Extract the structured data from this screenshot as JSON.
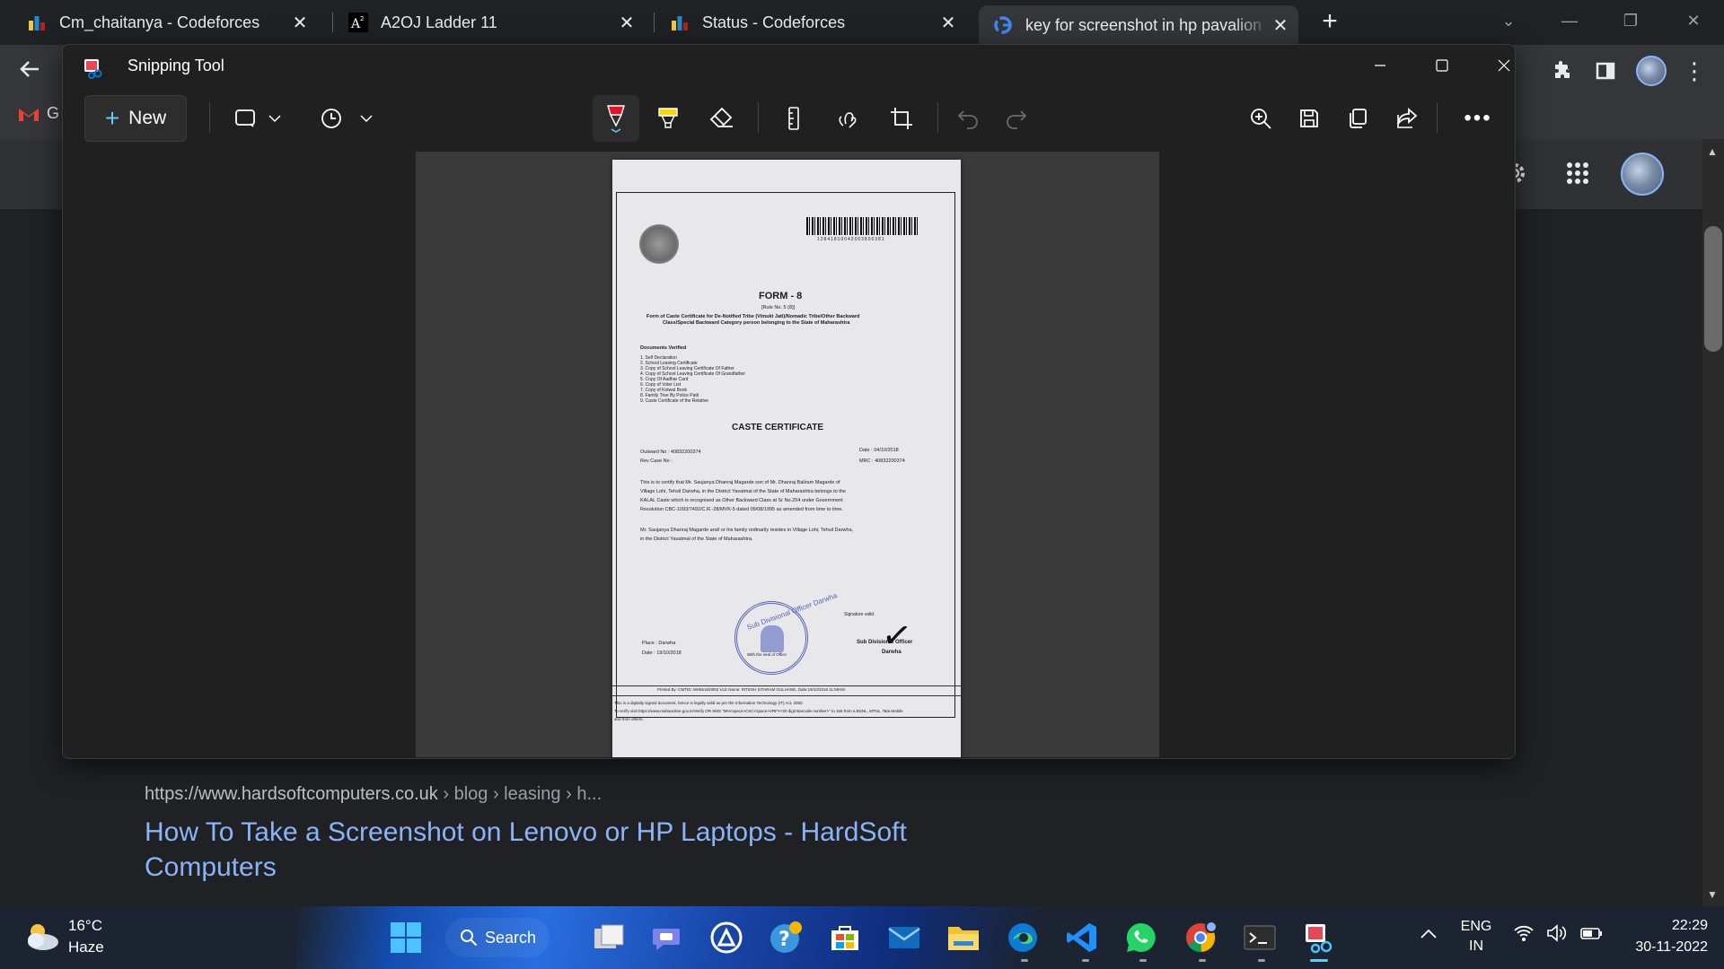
{
  "browser": {
    "tabs": [
      {
        "title": "Cm_chaitanya - Codeforces",
        "icon": "codeforces-icon",
        "active": false
      },
      {
        "title": "A2OJ Ladder 11",
        "icon": "a2oj-icon",
        "active": false
      },
      {
        "title": "Status - Codeforces",
        "icon": "codeforces-icon",
        "active": false
      },
      {
        "title": "key for screenshot in hp pavalion",
        "icon": "google-icon",
        "active": true
      }
    ],
    "new_tab": "+",
    "bookmark_gmail": "G",
    "colors": {
      "frame": "#202124",
      "toolbar": "#35363a",
      "link": "#8ab4f8"
    }
  },
  "search_result": {
    "url": "https://www.hardsoftcomputers.co.uk",
    "crumbs": "› blog › leasing › h...",
    "title": "How To Take a Screenshot on Lenovo or HP Laptops - HardSoft Computers"
  },
  "snipping_tool": {
    "title": "Snipping Tool",
    "new_label": "New",
    "toolbar_icons": [
      "snip-mode-icon",
      "delay-timer-icon",
      "ballpoint-pen-icon",
      "highlighter-icon",
      "eraser-icon",
      "ruler-icon",
      "touch-writing-icon",
      "crop-icon",
      "undo-icon",
      "redo-icon",
      "zoom-in-icon",
      "save-icon",
      "copy-icon",
      "share-icon",
      "more-icon"
    ],
    "colors": {
      "window": "#202020",
      "accent": "#60cdff",
      "pen": "#e81123",
      "highlighter": "#ffd700"
    }
  },
  "document": {
    "form_title": "FORM - 8",
    "rule": "[Rule No. 5 (8)]",
    "intro_1": "Form of Caste Certificate for De-Notified Tribe (Vimukt Jati)/Nomadic Tribe/Other Backward",
    "intro_2": "Class/Special Backward Category person belonging to the State of Maharashtra",
    "docs_heading": "Documents Verified",
    "docs": [
      "1.  Self Declaration",
      "2.  School Leaving Certificate",
      "3.  Copy of School Leaving Certificate Of Father",
      "4.  Copy of School Leaving Certificate Of Grandfather",
      "5.  Copy Of Aadhar Card",
      "6.  Copy of Voter List",
      "7.  Copy of Kotwal Book",
      "8.  Family Tree By Police Patil",
      "9.  Caste Certificate of the Relative"
    ],
    "heading": "CASTE CERTIFICATE",
    "outward": "Outward No   :  40832200374",
    "rev_case": "Rev Case No  :",
    "date_line": "Date   :  04/10/2018",
    "mrc": "MRC   :  40832200374",
    "body_1": "This is to certify that Mr. Saujanya Dhanraj Magarde son  of  Mr. Dhanraj Baliram Magarde of",
    "body_2": "Village Lohi, Tehsil Darwha, in the District Yavatmal of the State of Maharashtra belongs to the",
    "body_3": "KALAL Caste which is recognised as Other Backward Class at Sr No.254  under Government",
    "body_4": "Resolution  CBC-1093/7492/C.R.-28/MVK-5  dated  09/08/1995  as amended from time to time.",
    "res_1": "Mr. Saujanya Dhanraj Magarde and/ or his family ordinarily resides in Village Lohi, Tehsil Darwha,",
    "res_2": "in the District Yavatmal of the State of Maharashtra.",
    "place": "Place  :  Darwha",
    "sign_date": "Date   :  19/10/2018",
    "sig_valid": "Signature valid",
    "officer": "Sub Divisional Officer",
    "officer_place": "Darwha",
    "seal_note": "With the seal of Office",
    "stamp_text": "Sub Divisional Officer Darwha",
    "printed_by": "Printed By :CMTID: MH5516/0002 VLE Name: RITESH SITARAM GULHANE, Date:19/10/2018 11:59AM",
    "barcode_digits": "12841810042003800381",
    "footer_1": "This is a digitally signed document, hence is legally valid as per the Information Technology (IT) Act, 2000.",
    "footer_2": "To verify visit https://www.mahaonline.gov.in/Verify OR SMS \"MH<space>CSC<space>VRFY<20 digit Barcode number>\" to 166 from a BSNL, MTNL, Tata Mobile",
    "footer_3": "and from others."
  },
  "taskbar": {
    "temperature": "16°C",
    "condition": "Haze",
    "search_label": "Search",
    "apps": [
      "start-icon",
      "task-view-icon",
      "teams-chat-icon",
      "app-circle-icon",
      "help-icon",
      "store-icon",
      "mail-icon",
      "file-explorer-icon",
      "edge-icon",
      "vscode-icon",
      "whatsapp-icon",
      "chrome-icon",
      "terminal-icon",
      "snipping-tool-icon"
    ],
    "language_1": "ENG",
    "language_2": "IN",
    "time": "22:29",
    "date": "30-11-2022"
  }
}
